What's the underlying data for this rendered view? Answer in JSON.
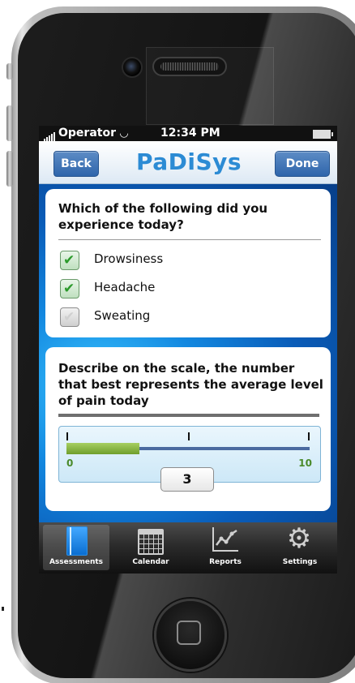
{
  "status_bar": {
    "carrier": "Operator",
    "time": "12:34 PM"
  },
  "nav": {
    "back": "Back",
    "title": "PaDiSys",
    "done": "Done"
  },
  "symptoms": {
    "question": "Which of the following did you experience today?",
    "options": [
      {
        "label": "Drowsiness",
        "checked": true
      },
      {
        "label": "Headache",
        "checked": true
      },
      {
        "label": "Sweating",
        "checked": false
      }
    ]
  },
  "pain": {
    "question": "Describe on the scale, the number that best represents the average level of pain today",
    "min_label": "0",
    "max_label": "10",
    "value": 3,
    "value_text": "3"
  },
  "tabs": [
    {
      "label": "Assessments",
      "icon": "book-icon",
      "active": true
    },
    {
      "label": "Calendar",
      "icon": "calendar-icon",
      "active": false
    },
    {
      "label": "Reports",
      "icon": "chart-icon",
      "active": false
    },
    {
      "label": "Settings",
      "icon": "gear-icon",
      "active": false
    }
  ],
  "colors": {
    "brand": "#2c8bd4",
    "nav_button": "#3a70b5",
    "check": "#2b9a2b",
    "slider_fill": "#8cbb45"
  }
}
